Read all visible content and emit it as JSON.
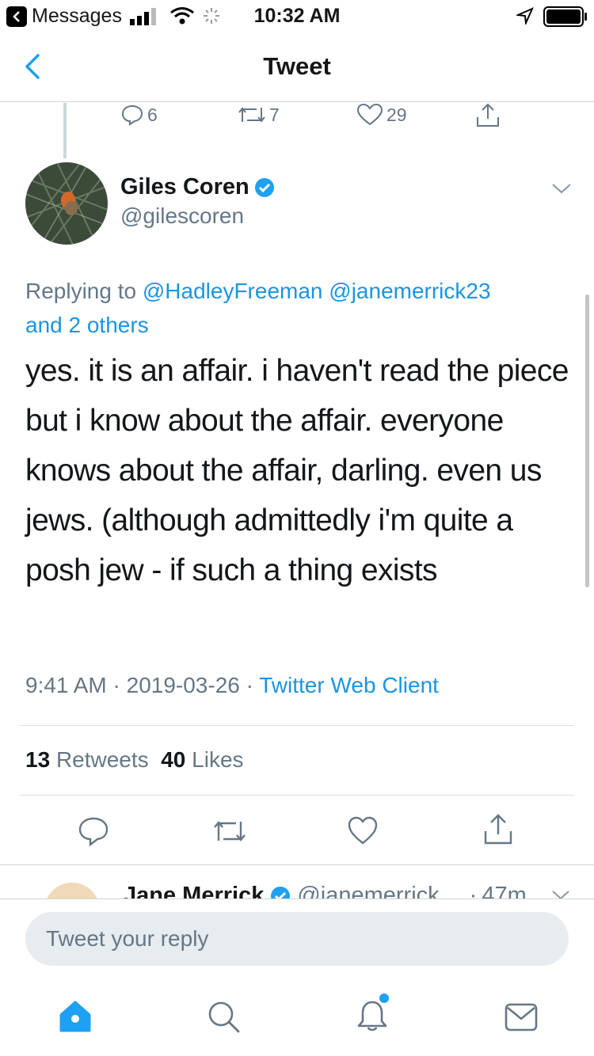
{
  "status_bar": {
    "back_app": "Messages",
    "time": "10:32 AM"
  },
  "nav": {
    "title": "Tweet"
  },
  "parent_tweet_actions": {
    "replies": "6",
    "retweets": "7",
    "likes": "29"
  },
  "tweet": {
    "author_name": "Giles Coren",
    "author_handle": "@gilescoren",
    "replying_prefix": "Replying to",
    "replying_to": "@HadleyFreeman @janemerrick23",
    "replying_others": "and 2 others",
    "text": "yes. it is an affair. i haven't read the piece but i know about the affair. everyone knows about the affair, darling. even us jews. (although admittedly i'm quite a posh jew - if such a thing exists",
    "time": "9:41 AM",
    "date": "2019-03-26",
    "source": "Twitter Web Client",
    "retweet_count": "13",
    "retweet_label": "Retweets",
    "like_count": "40",
    "like_label": "Likes"
  },
  "next_reply": {
    "author_name": "Jane Merrick",
    "author_handle": "@janemerrick",
    "age": "47m"
  },
  "reply_box": {
    "placeholder": "Tweet your reply"
  },
  "tab_bar": [
    "home-icon",
    "search-icon",
    "notifications-icon",
    "messages-icon"
  ],
  "colors": {
    "accent": "#1da1f2",
    "link": "#1b95e0",
    "muted": "#657786"
  }
}
